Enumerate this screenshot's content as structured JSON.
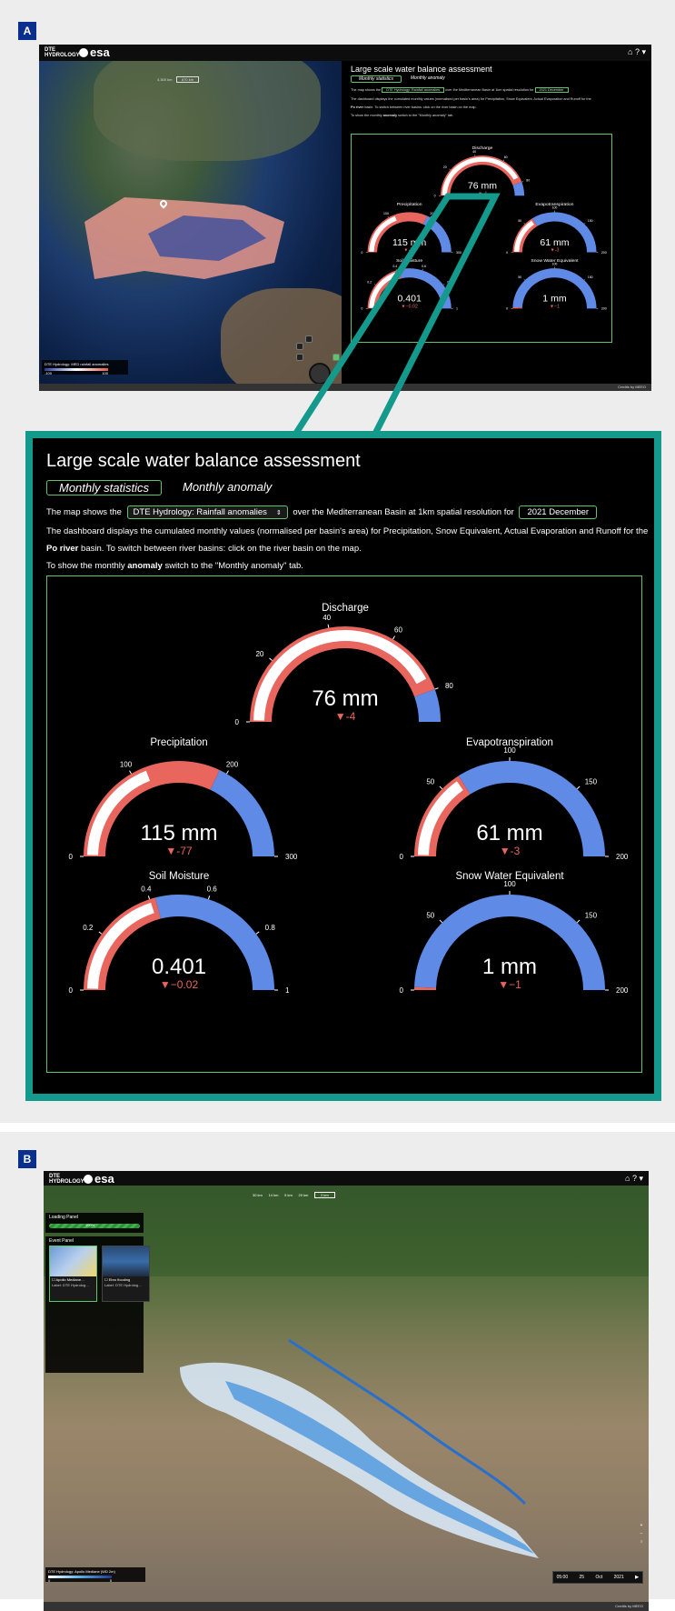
{
  "panels": {
    "a": "A",
    "b": "B"
  },
  "app": {
    "logo_line1": "DTE",
    "logo_line2": "HYDROLOGY",
    "esa": "esa",
    "home_icon": "home-icon",
    "help": "? ▾"
  },
  "map_a": {
    "scale_1": "4,300 km",
    "scale_2": "870 km",
    "legend_title": "DTE Hydrology: MED rainfall anomalies",
    "legend_min": "-100",
    "legend_max": "100",
    "credits": "Credits by  MEEO"
  },
  "dashboard": {
    "title": "Large scale water balance assessment",
    "tab_active": "Monthly statistics",
    "tab_inactive": "Monthly anomaly",
    "line1_pre": "The map shows the",
    "layer_select": "DTE Hydrology: Rainfall anomalies",
    "line1_post": "over the Mediterranean Basin at 1km spatial resolution for",
    "date": "2021 December",
    "line2": "The dashboard displays the cumulated monthly values (normalised per basin's area) for Precipitation, Snow Equivalent, Actual Evaporation and Runoff for the",
    "line3_bold": "Po river",
    "line3_post": "basin. To switch between river basins: click on the river basin on the map.",
    "line4_pre": "To show the monthly",
    "line4_bold": "anomaly",
    "line4_post": "switch to the \"Monthly anomaly\" tab."
  },
  "chart_data": [
    {
      "type": "gauge",
      "title": "Discharge",
      "value": 76,
      "unit": "mm",
      "display": "76 mm",
      "delta": -4,
      "delta_label": "▼-4",
      "min": 0,
      "max": 90,
      "reference": 80,
      "ticks": [
        0,
        20,
        40,
        60,
        80
      ]
    },
    {
      "type": "gauge",
      "title": "Precipitation",
      "value": 115,
      "unit": "mm",
      "display": "115 mm",
      "delta": -77,
      "delta_label": "▼-77",
      "min": 0,
      "max": 300,
      "reference": 192,
      "ticks": [
        0,
        100,
        200,
        300
      ]
    },
    {
      "type": "gauge",
      "title": "Evapotranspiration",
      "value": 61,
      "unit": "mm",
      "display": "61 mm",
      "delta": -3,
      "delta_label": "▼-3",
      "min": 0,
      "max": 200,
      "reference": 64,
      "ticks": [
        0,
        50,
        100,
        150,
        200
      ]
    },
    {
      "type": "gauge",
      "title": "Soil Moisture",
      "value": 0.401,
      "unit": "",
      "display": "0.401",
      "delta": -0.02,
      "delta_label": "▼−0.02",
      "min": 0,
      "max": 1,
      "reference": 0.42,
      "ticks": [
        0,
        0.2,
        0.4,
        0.6,
        0.8,
        1
      ]
    },
    {
      "type": "gauge",
      "title": "Snow Water Equivalent",
      "value": 1,
      "unit": "mm",
      "display": "1 mm",
      "delta": -1,
      "delta_label": "▼−1",
      "min": 0,
      "max": 200,
      "reference": 2,
      "ticks": [
        0,
        50,
        100,
        150,
        200
      ]
    }
  ],
  "gauge_colors": {
    "filled": "#ffffff",
    "reference": "#e8665e",
    "remaining": "#5f8ae6",
    "delta": "#e8665e"
  },
  "map_b": {
    "labels": [
      "30 km",
      "14 km",
      "5 km",
      "20 km",
      "2 km"
    ],
    "loading_title": "Loading Panel",
    "loading_text": "100%",
    "event_title": "Event Panel",
    "cards": [
      {
        "title": "☐ Apollo Mediane…",
        "label": "Label: DTE Hydrolog…"
      },
      {
        "title": "☐ Ebro flooding",
        "label": "Label: DTE Hydrolog…"
      }
    ],
    "legend_title": "DTE Hydrology: Apollo Mediane (WD 2m)",
    "legend_min": "0",
    "legend_max": "5",
    "time": {
      "hour": "05:00",
      "day": "25",
      "month": "Oct",
      "year": "2021"
    },
    "credits": "Credits by  MEEO"
  }
}
